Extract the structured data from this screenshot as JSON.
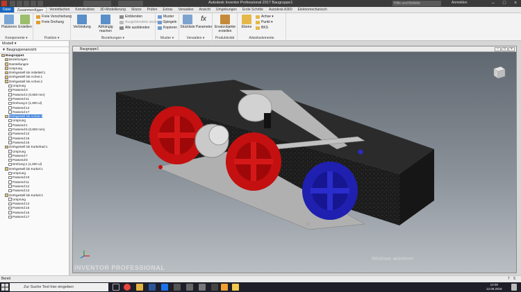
{
  "window": {
    "title": "Autodesk Inventor Professional 2017    Baugruppe1",
    "search_placeholder": "Hilfe und Befehle durchsuchen",
    "user": "Anmelden"
  },
  "ribbon_tabs": [
    "Datei",
    "Zusammenfügen",
    "Vereinfachen",
    "Konstruktion",
    "3D-Modellierung",
    "Skizze",
    "Prüfen",
    "Extras",
    "Verwalten",
    "Ansicht",
    "Umgebungen",
    "Erste Schritte",
    "Autodesk A360",
    "Elektromechanisch"
  ],
  "ribbon": {
    "groups": [
      {
        "label": "Komponente ▾",
        "big": [
          "Platzieren",
          "Erstellen"
        ]
      },
      {
        "label": "Position ▾",
        "small": [
          "Freie Verschiebung",
          "Freie Drehung"
        ]
      },
      {
        "label": "Beziehungen ▾",
        "big": [
          "Verbindung",
          "Abhängig machen"
        ],
        "small": [
          "Einblenden",
          "Ausgeblendete anzeigen",
          "Alle ausblenden"
        ]
      },
      {
        "label": "Muster ▾",
        "small": [
          "Muster",
          "Spiegeln",
          "Kopieren"
        ]
      },
      {
        "label": "Verwalten ▾",
        "big": [
          "Stückliste",
          "Parameter"
        ]
      },
      {
        "label": "Produktivität",
        "big": [
          "Ersatzobjekte erstellen"
        ]
      },
      {
        "label": "Arbeitselemente",
        "big": [
          "Ebene"
        ],
        "small": [
          "Achse ▾",
          "Punkt ▾",
          "BKS"
        ]
      }
    ]
  },
  "browser": {
    "title": "Modell ▾",
    "toolbar": "Baugruppenansicht",
    "items": [
      {
        "label": "Baugruppe1",
        "indent": 0,
        "bold": true
      },
      {
        "label": "Beziehungen",
        "indent": 1
      },
      {
        "label": "Darstellungen",
        "indent": 1
      },
      {
        "label": "Ursprung",
        "indent": 1
      },
      {
        "label": "Drehgestell lok mittelteil:1",
        "indent": 1
      },
      {
        "label": "Drehgestell lok Achse:1",
        "indent": 1
      },
      {
        "label": "Drehgestell lok Achse:2",
        "indent": 1
      },
      {
        "label": "Ursprung",
        "indent": 2
      },
      {
        "label": "Passend:3",
        "indent": 2
      },
      {
        "label": "Passend:4 (0,500 mm)",
        "indent": 2
      },
      {
        "label": "Passend:11",
        "indent": 2
      },
      {
        "label": "Drehung:2 (1,000 ul)",
        "indent": 2
      },
      {
        "label": "Passend:14",
        "indent": 2
      },
      {
        "label": "Passend:17",
        "indent": 2
      },
      {
        "label": "Drehgestell lok Achse:3",
        "indent": 1,
        "selected": true
      },
      {
        "label": "Ursprung",
        "indent": 2
      },
      {
        "label": "Passend:1",
        "indent": 2
      },
      {
        "label": "Passend:6 (0,500 mm)",
        "indent": 2
      },
      {
        "label": "Passend:12",
        "indent": 2
      },
      {
        "label": "Passend:15",
        "indent": 2
      },
      {
        "label": "Passend:16",
        "indent": 2
      },
      {
        "label": "Drehgestell lok Kurbelrad:1",
        "indent": 1
      },
      {
        "label": "Ursprung",
        "indent": 2
      },
      {
        "label": "Passend:7",
        "indent": 2
      },
      {
        "label": "Passend:8",
        "indent": 2
      },
      {
        "label": "Drehung:1 (1,000 ul)",
        "indent": 2
      },
      {
        "label": "Drehgestell lok Kurbel:1",
        "indent": 1
      },
      {
        "label": "Ursprung",
        "indent": 2
      },
      {
        "label": "Passend:10",
        "indent": 2
      },
      {
        "label": "Passend:11",
        "indent": 2
      },
      {
        "label": "Passend:12",
        "indent": 2
      },
      {
        "label": "Passend:13",
        "indent": 2
      },
      {
        "label": "Drehgestell lok Kurbel:2",
        "indent": 1
      },
      {
        "label": "Ursprung",
        "indent": 2
      },
      {
        "label": "Passend:14",
        "indent": 2
      },
      {
        "label": "Passend:15",
        "indent": 2
      },
      {
        "label": "Passend:16",
        "indent": 2
      },
      {
        "label": "Passend:17",
        "indent": 2
      }
    ]
  },
  "viewport": {
    "doc_title": "Baugruppe1",
    "brand": "INVENTOR  PROFESSIONAL",
    "watermark": "Windows aktivieren",
    "viewcube_label": "VORNE"
  },
  "status": {
    "text": "Bereit",
    "count1": "7",
    "count2": "5"
  },
  "taskbar": {
    "search_placeholder": "Zur Suche Text hier eingeben",
    "time": "10:09",
    "date": "12.08.2018"
  },
  "colors": {
    "frame": "#1c1c1c",
    "wheel_red": "#c41010",
    "wheel_blue": "#1f20b0",
    "link_gray": "#b5b5b5"
  }
}
